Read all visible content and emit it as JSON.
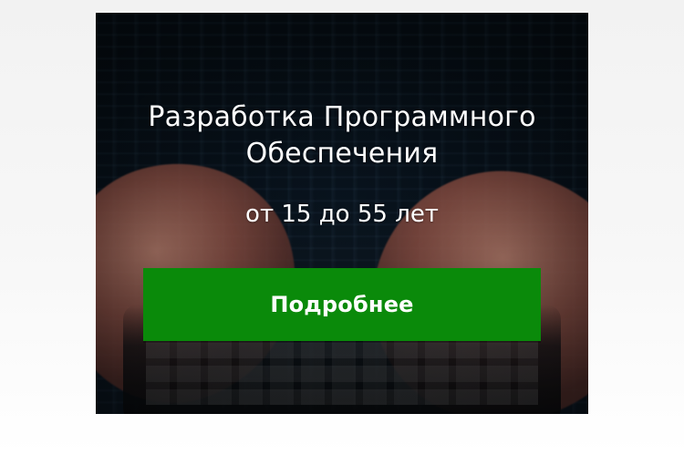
{
  "ad": {
    "title_lines": [
      "Разработка Программного",
      "Обеспечения"
    ],
    "age_range": "от 15 до 55 лет",
    "cta_label": "Подробнее"
  },
  "colors": {
    "cta_background": "#0a8a0a",
    "text": "#ffffff",
    "page_background": "#f4f4f4"
  }
}
